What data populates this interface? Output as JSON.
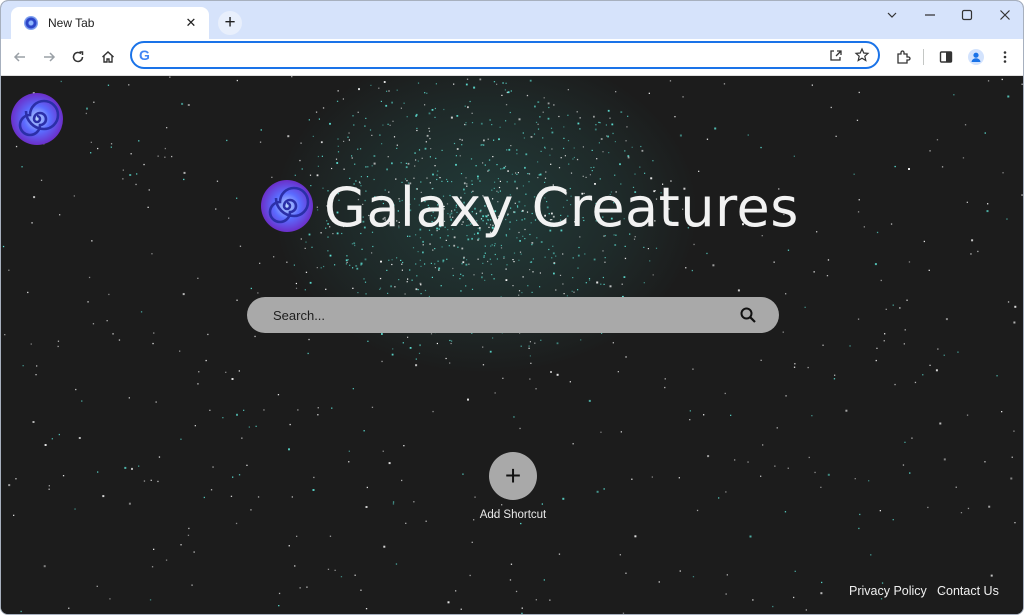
{
  "tab": {
    "title": "New Tab",
    "close_glyph": "✕"
  },
  "new_tab_glyph": "+",
  "window_controls": [
    "chevron-down-icon",
    "minimize-icon",
    "maximize-icon",
    "close-icon"
  ],
  "toolbar": {
    "omnibox_value": "",
    "icons": [
      "back-arrow-icon",
      "forward-arrow-icon",
      "reload-icon",
      "home-icon",
      "share-icon",
      "bookmark-star-icon",
      "extensions-icon",
      "side-panel-icon",
      "profile-icon",
      "more-options-icon"
    ]
  },
  "content": {
    "brand_title": "Galaxy Creatures",
    "search_placeholder": "Search...",
    "shortcut": {
      "glyph": "+",
      "label": "Add Shortcut"
    },
    "footer": {
      "privacy": "Privacy Policy",
      "contact": "Contact Us"
    }
  },
  "colors": {
    "tabstrip": "#d6e3fb",
    "omnibox_border": "#1a73e8",
    "background": "#1c1c1c",
    "search_bar": "#a9a9a9",
    "star_teal": "#5ee3d6"
  }
}
